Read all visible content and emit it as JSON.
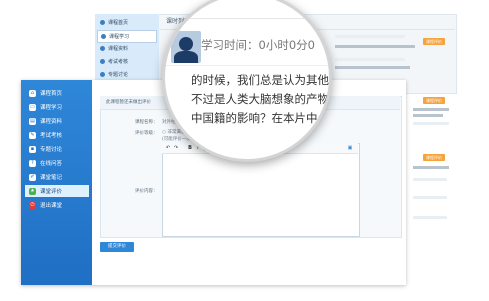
{
  "back": {
    "nav": [
      {
        "label": "课程首页",
        "active": false
      },
      {
        "label": "课程学习",
        "active": true
      },
      {
        "label": "课程资料",
        "active": false
      },
      {
        "label": "考试考核",
        "active": false
      },
      {
        "label": "专题讨论",
        "active": false
      }
    ],
    "header_title": "课时列表",
    "badges": [
      "课程评价",
      "课程评价",
      "课程评价"
    ]
  },
  "main": {
    "nav": [
      {
        "label": "课程首页"
      },
      {
        "label": "课程学习"
      },
      {
        "label": "课程资料"
      },
      {
        "label": "考试考核"
      },
      {
        "label": "专题讨论"
      },
      {
        "label": "在线问答"
      },
      {
        "label": "课堂笔记"
      },
      {
        "label": "课堂评价"
      },
      {
        "label": "退出课堂"
      }
    ],
    "tip": "此课程暂还未做出评价",
    "form": {
      "course_label": "课程名称：",
      "course_value": "对外经济贸易大学...",
      "rating_label": "评价等级：",
      "rating_options": [
        "非常满意",
        "满意"
      ],
      "rating_hint": "(可能评价一次，请...)",
      "content_label": "评价内容："
    },
    "editor_tools": [
      "B",
      "I",
      "U"
    ],
    "submit_label": "提交评价"
  },
  "lens": {
    "line1": "学习时间：0小时0分0",
    "line2": "的时候，我们总是认为其他",
    "line3": "不过是人类大脑想象的产物",
    "line4": "中国籍的影响？在本片中"
  }
}
